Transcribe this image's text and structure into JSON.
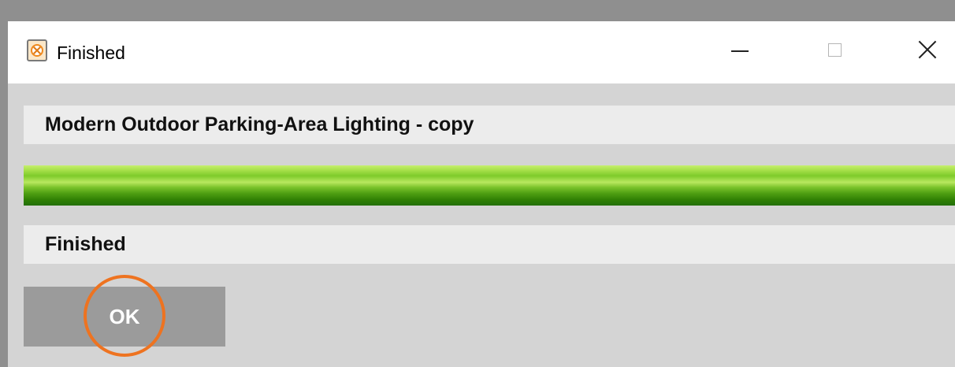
{
  "window": {
    "title": "Finished",
    "icon": "app-logo-icon",
    "controls": {
      "minimize": "minimize-icon",
      "maximize": "maximize-icon",
      "close": "close-icon"
    }
  },
  "dialog": {
    "item_name": "Modern Outdoor Parking-Area Lighting - copy",
    "progress_fraction": 1.0,
    "status_text": "Finished",
    "ok_label": "OK"
  },
  "colors": {
    "progress_green": "#4e9e12",
    "progress_highlight": "#c6ef6e",
    "highlight_ring": "#ee7320",
    "ok_button": "#9b9b9b"
  }
}
